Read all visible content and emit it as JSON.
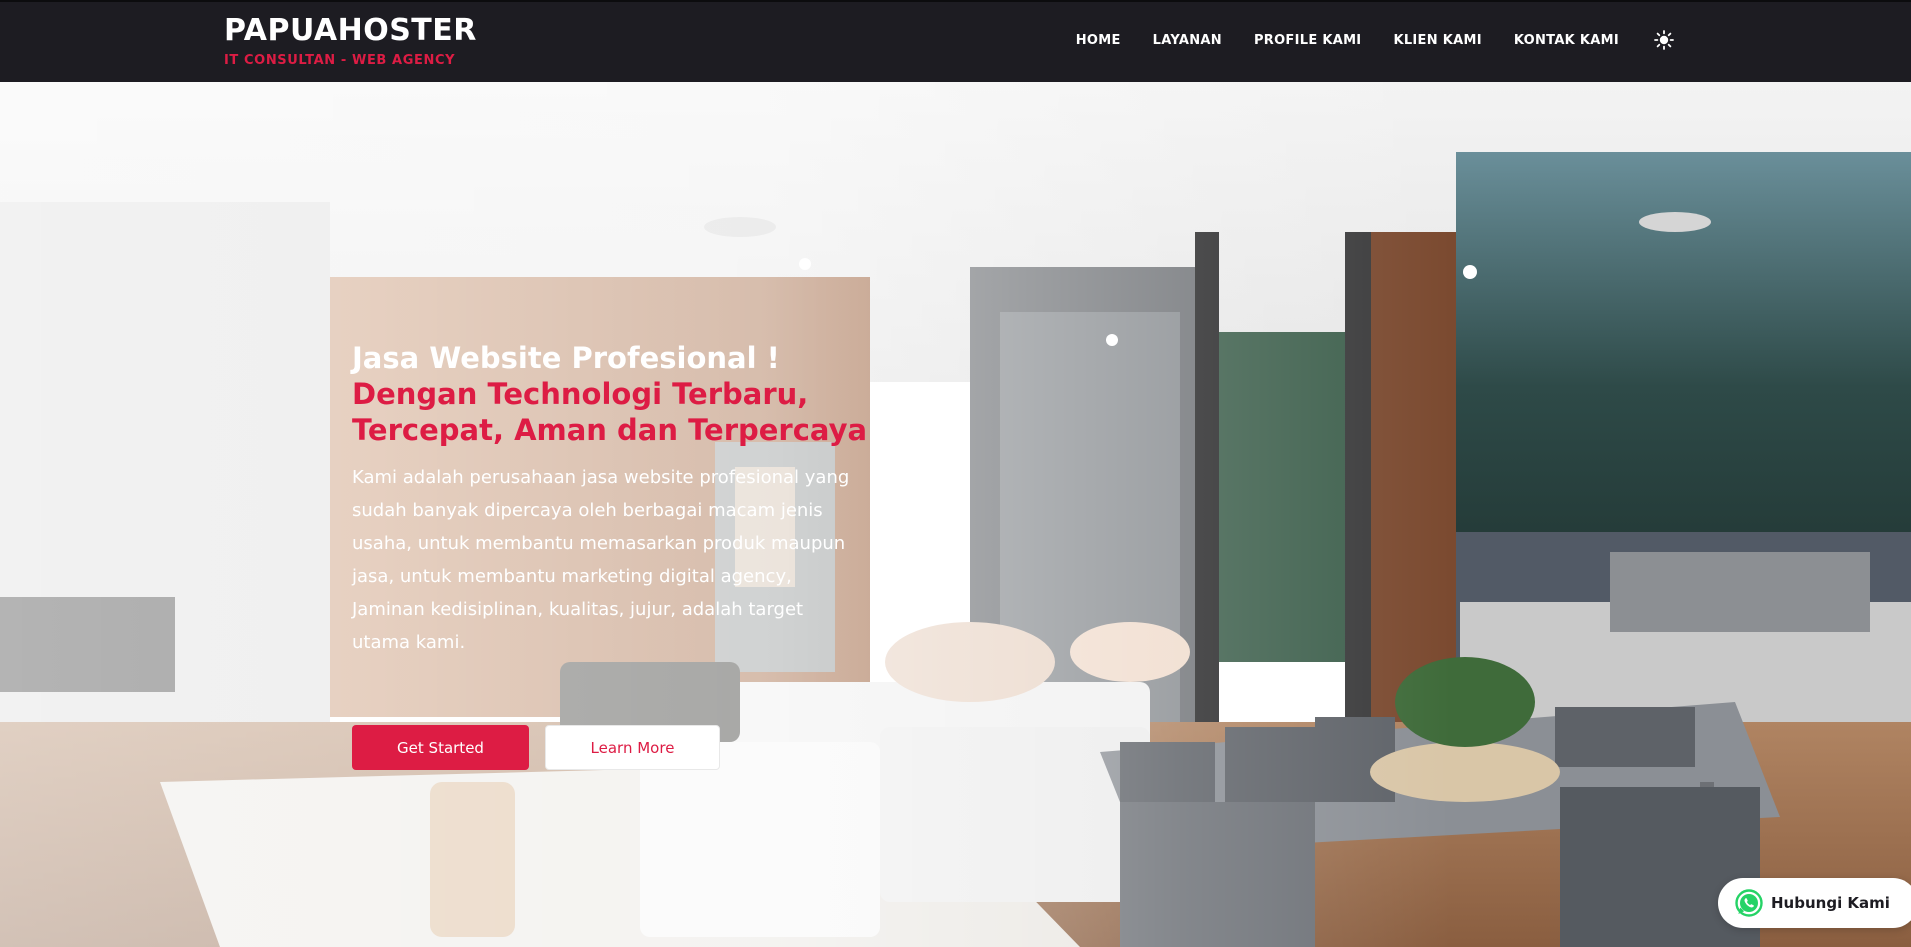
{
  "brand": {
    "name": "PAPUAHOSTER",
    "tagline": "IT CONSULTAN - WEB AGENCY"
  },
  "nav": {
    "items": [
      {
        "label": "HOME"
      },
      {
        "label": "LAYANAN"
      },
      {
        "label": "PROFILE KAMI"
      },
      {
        "label": "KLIEN KAMI"
      },
      {
        "label": "KONTAK KAMI"
      }
    ],
    "theme_toggle_icon": "sun-icon"
  },
  "hero": {
    "title_line1": "Jasa Website Profesional !",
    "title_line2": "Dengan Technologi Terbaru, Tercepat, Aman dan Terpercaya",
    "description": "Kami adalah perusahaan jasa website profesional yang sudah banyak dipercaya oleh berbagai macam jenis usaha, untuk membantu memasarkan produk maupun jasa, untuk membantu marketing digital agency, Jaminan kedisiplinan, kualitas, jujur, adalah target utama kami.",
    "primary_button": "Get Started",
    "secondary_button": "Learn More",
    "background_image": "modern-interior-living-dining-photo"
  },
  "whatsapp": {
    "label": "Hubungi Kami",
    "icon": "whatsapp-icon"
  },
  "colors": {
    "navbar_bg": "#1d1c22",
    "accent": "#dd1c44",
    "whatsapp": "#25d366"
  }
}
